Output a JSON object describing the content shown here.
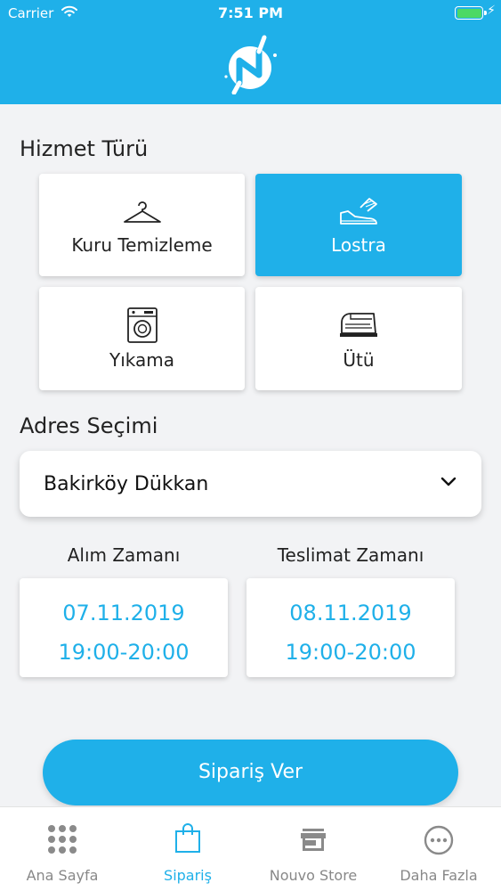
{
  "status_bar": {
    "carrier": "Carrier",
    "time": "7:51 PM"
  },
  "colors": {
    "brand": "#1fb0e9",
    "background": "#f2f3f5",
    "battery": "#4cd964",
    "tab_inactive": "#888888"
  },
  "service_section": {
    "title": "Hizmet Türü",
    "options": [
      {
        "label": "Kuru Temizleme",
        "icon": "hanger-icon",
        "selected": false
      },
      {
        "label": "Lostra",
        "icon": "shoe-shine-icon",
        "selected": true
      },
      {
        "label": "Yıkama",
        "icon": "washing-machine-icon",
        "selected": false
      },
      {
        "label": "Ütü",
        "icon": "iron-icon",
        "selected": false
      }
    ]
  },
  "address_section": {
    "title": "Adres Seçimi",
    "selected": "Bakirköy Dükkan"
  },
  "pickup": {
    "title": "Alım Zamanı",
    "date": "07.11.2019",
    "time": "19:00-20:00"
  },
  "delivery": {
    "title": "Teslimat Zamanı",
    "date": "08.11.2019",
    "time": "19:00-20:00"
  },
  "order_button": {
    "label": "Sipariş Ver"
  },
  "tabbar": {
    "items": [
      {
        "label": "Ana Sayfa",
        "icon": "grid-icon",
        "active": false
      },
      {
        "label": "Sipariş",
        "icon": "shopping-bag-icon",
        "active": true
      },
      {
        "label": "Nouvo Store",
        "icon": "store-icon",
        "active": false
      },
      {
        "label": "Daha Fazla",
        "icon": "more-icon",
        "active": false
      }
    ]
  }
}
